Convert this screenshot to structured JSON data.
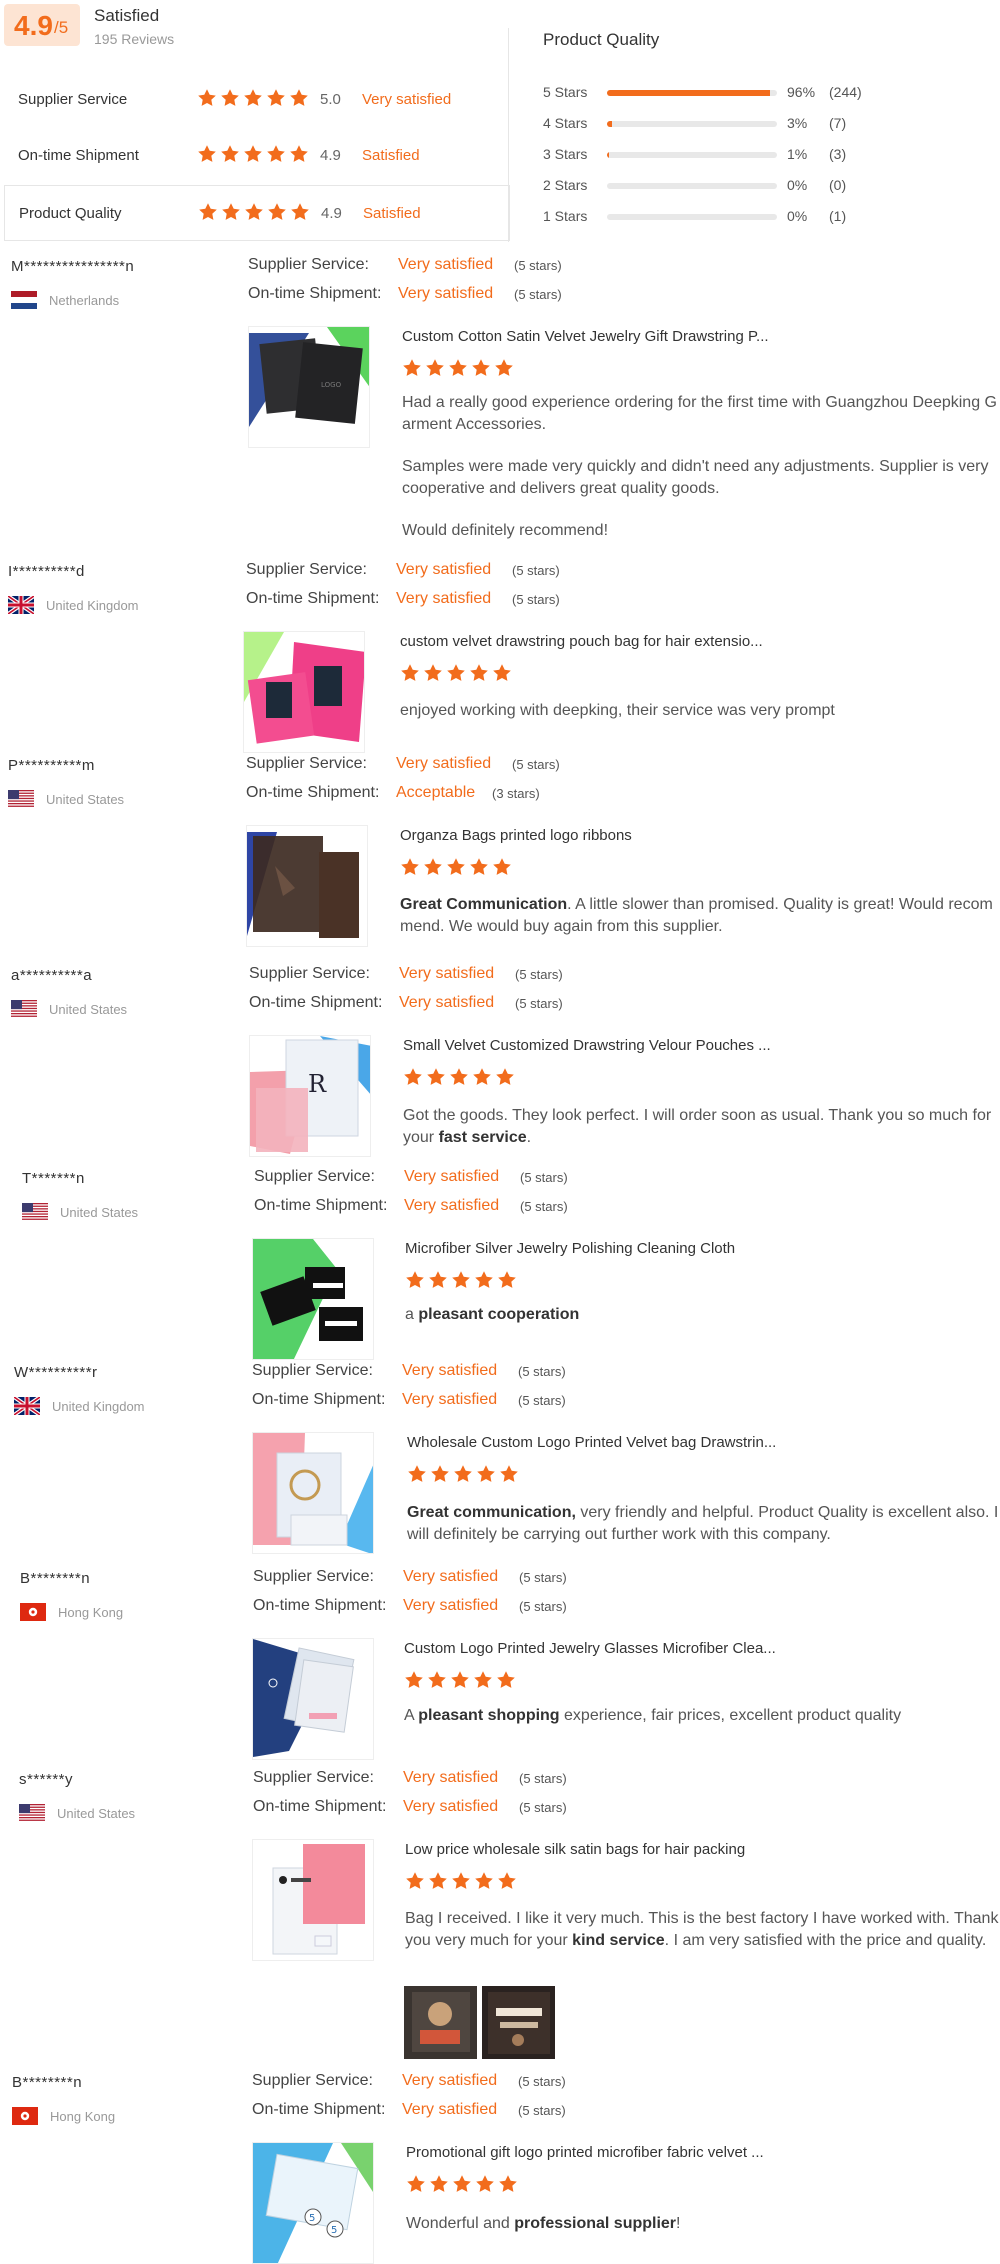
{
  "summary": {
    "score": "4.9",
    "score_suffix": "/5",
    "title": "Satisfied",
    "reviews_count": "195 Reviews",
    "rows": [
      {
        "label": "Supplier Service",
        "score": "5.0",
        "text": "Very satisfied",
        "stars": 5
      },
      {
        "label": "On-time Shipment",
        "score": "4.9",
        "text": "Satisfied",
        "stars": 5
      },
      {
        "label": "Product Quality",
        "score": "4.9",
        "text": "Satisfied",
        "stars": 5
      }
    ],
    "quality_title": "Product Quality",
    "distribution": [
      {
        "label": "5 Stars",
        "percent": "96%",
        "count": "(244)",
        "fill": 0.96
      },
      {
        "label": "4 Stars",
        "percent": "3%",
        "count": "(7)",
        "fill": 0.03
      },
      {
        "label": "3 Stars",
        "percent": "1%",
        "count": "(3)",
        "fill": 0.01
      },
      {
        "label": "2 Stars",
        "percent": "0%",
        "count": "(0)",
        "fill": 0
      },
      {
        "label": "1 Stars",
        "percent": "0%",
        "count": "(1)",
        "fill": 0
      }
    ]
  },
  "labels": {
    "supplier_service": "Supplier Service:",
    "on_time_shipment": "On-time Shipment:"
  },
  "reviews": [
    {
      "user": "M****************n",
      "country": "Netherlands",
      "flag": "nl",
      "service_text": "Very satisfied",
      "service_stars": "(5 stars)",
      "shipment_text": "Very satisfied",
      "shipment_stars": "(5 stars)",
      "product": "Custom Cotton Satin Velvet Jewelry Gift Drawstring P...",
      "rating": 5,
      "thumb": "dark-green",
      "body": [
        "Had a really good experience ordering for the first time with Guangzhou Deepking Garment Accessories.",
        "Samples were made very quickly and didn't need any adjustments. Supplier is very cooperative and delivers great quality goods.",
        "Would definitely recommend!"
      ]
    },
    {
      "user": "I**********d",
      "country": "United Kingdom",
      "flag": "gb",
      "service_text": "Very satisfied",
      "service_stars": "(5 stars)",
      "shipment_text": "Very satisfied",
      "shipment_stars": "(5 stars)",
      "product": "custom velvet drawstring pouch bag for hair extensio...",
      "rating": 5,
      "thumb": "pink-green",
      "body": [
        "enjoyed working with deepking, their service was very prompt"
      ]
    },
    {
      "user": "P**********m",
      "country": "United States",
      "flag": "us",
      "service_text": "Very satisfied",
      "service_stars": "(5 stars)",
      "shipment_text": "Acceptable",
      "shipment_stars": "(3 stars)",
      "product": "Organza Bags printed logo ribbons",
      "rating": 5,
      "thumb": "brown-blue",
      "body_bold": "Great Communication",
      "body_rest": ". A little slower than promised. Quality is great! Would recommend. We would buy again from this supplier."
    },
    {
      "user": "a**********a",
      "country": "United States",
      "flag": "us",
      "service_text": "Very satisfied",
      "service_stars": "(5 stars)",
      "shipment_text": "Very satisfied",
      "shipment_stars": "(5 stars)",
      "product": "Small Velvet Customized Drawstring Velour Pouches ...",
      "rating": 5,
      "thumb": "pink-clear",
      "body_pre": "Got the goods. They look perfect. I will order soon as usual. Thank you so much for your ",
      "body_bold": "fast service",
      "body_post": "."
    },
    {
      "user": "T*******n",
      "country": "United States",
      "flag": "us",
      "service_text": "Very satisfied",
      "service_stars": "(5 stars)",
      "shipment_text": "Very satisfied",
      "shipment_stars": "(5 stars)",
      "product": "Microfiber Silver Jewelry Polishing Cleaning Cloth",
      "rating": 5,
      "thumb": "green-black",
      "body_pre": "a ",
      "body_bold": "pleasant cooperation",
      "body_post": ""
    },
    {
      "user": "W**********r",
      "country": "United Kingdom",
      "flag": "gb",
      "service_text": "Very satisfied",
      "service_stars": "(5 stars)",
      "shipment_text": "Very satisfied",
      "shipment_stars": "(5 stars)",
      "product": "Wholesale Custom Logo Printed Velvet bag Drawstrin...",
      "rating": 5,
      "thumb": "pink-blue",
      "body_bold": "Great communication,",
      "body_rest": " very friendly and helpful.  Product Quality is excellent also. I will definitely be carrying out further work with this company."
    },
    {
      "user": "B********n",
      "country": "Hong Kong",
      "flag": "hk",
      "service_text": "Very satisfied",
      "service_stars": "(5 stars)",
      "shipment_text": "Very satisfied",
      "shipment_stars": "(5 stars)",
      "product": "Custom Logo Printed Jewelry Glasses Microfiber Clea...",
      "rating": 5,
      "thumb": "navy-clear",
      "body_pre": "A ",
      "body_bold": "pleasant shopping",
      "body_post": " experience, fair prices, excellent product quality"
    },
    {
      "user": "s******y",
      "country": "United States",
      "flag": "us",
      "service_text": "Very satisfied",
      "service_stars": "(5 stars)",
      "shipment_text": "Very satisfied",
      "shipment_stars": "(5 stars)",
      "product": "Low price wholesale silk satin bags for hair packing",
      "rating": 5,
      "thumb": "white-pink",
      "body_pre": "Bag I received. I like it very much. This is the best factory I have worked with. Thank you very much for your ",
      "body_bold": "kind service",
      "body_post": ". I am very satisfied with the price and quality."
    },
    {
      "user": "B********n",
      "country": "Hong Kong",
      "flag": "hk",
      "service_text": "Very satisfied",
      "service_stars": "(5 stars)",
      "shipment_text": "Very satisfied",
      "shipment_stars": "(5 stars)",
      "product": "Promotional gift logo printed microfiber fabric velvet ...",
      "rating": 5,
      "thumb": "blue-clear",
      "body_pre": "Wonderful and ",
      "body_bold": "professional supplier",
      "body_post": "!"
    }
  ],
  "colors": {
    "accent": "#f26c1c",
    "bar_track": "#e8e8e8",
    "score_bg": "#fde4d3"
  },
  "icons": {
    "star": "star-icon"
  }
}
